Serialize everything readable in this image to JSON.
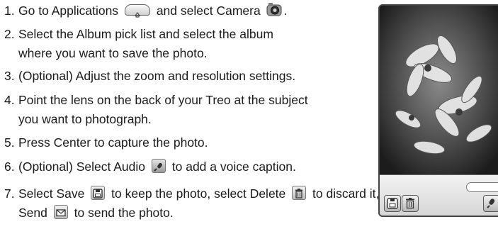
{
  "steps": [
    {
      "number": "1.",
      "text_a": "Go to Applications",
      "text_b": "and select Camera",
      "text_c": "."
    },
    {
      "number": "2.",
      "line1": "Select the Album pick list and select the album",
      "line2": "where you want to save the photo."
    },
    {
      "number": "3.",
      "text": "(Optional) Adjust the zoom and resolution settings."
    },
    {
      "number": "4.",
      "line1": "Point the lens on the back of your Treo at the subject",
      "line2": "you want to photograph."
    },
    {
      "number": "5.",
      "text": "Press Center to capture the photo."
    },
    {
      "number": "6.",
      "text_a": "(Optional) Select Audio",
      "text_b": "to add a voice caption."
    },
    {
      "number": "7.",
      "text_a": "Select Save",
      "text_b": "to keep the photo, select Delete",
      "text_c": "to discard it, or select",
      "line2_a": "Send",
      "line2_b": "to send the photo."
    }
  ],
  "icons": {
    "applications": "home-tab-icon",
    "camera": "camera-icon",
    "audio": "microphone-icon",
    "save": "floppy-disk-icon",
    "delete": "trash-can-icon",
    "send": "envelope-icon"
  }
}
